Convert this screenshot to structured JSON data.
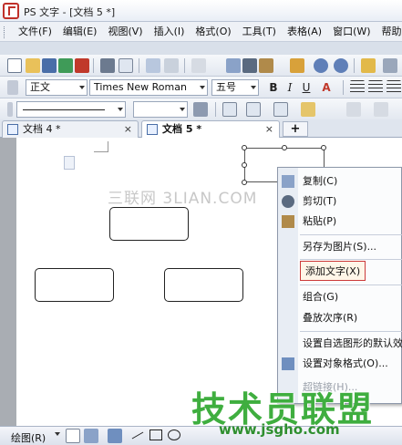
{
  "window": {
    "title": "PS 文字 - [文档 5 *]"
  },
  "menu": {
    "items": [
      {
        "label": "文件(F)"
      },
      {
        "label": "编辑(E)"
      },
      {
        "label": "视图(V)"
      },
      {
        "label": "插入(I)"
      },
      {
        "label": "格式(O)"
      },
      {
        "label": "工具(T)"
      },
      {
        "label": "表格(A)"
      },
      {
        "label": "窗口(W)"
      },
      {
        "label": "帮助(H)"
      }
    ]
  },
  "format_toolbar": {
    "style": "正文",
    "font": "Times New Roman",
    "size": "五号",
    "bold": "B",
    "italic": "I",
    "underline": "U",
    "font_color": "A"
  },
  "tabs": [
    {
      "label": "文档 4 *",
      "close": "×"
    },
    {
      "label": "文档 5 *",
      "close": "×"
    }
  ],
  "new_tab": "+",
  "watermark": {
    "top": "三联网 3LIAN.COM",
    "brand": "技术员联盟",
    "url": "www.jsgho.com"
  },
  "context_menu": {
    "items": [
      {
        "label": "复制(C)",
        "icon": "copy-icon"
      },
      {
        "label": "剪切(T)",
        "icon": "scissors-icon"
      },
      {
        "label": "粘贴(P)",
        "icon": "paste-icon"
      },
      {
        "label": "另存为图片(S)..."
      },
      {
        "label": "添加文字(X)",
        "highlighted": true
      },
      {
        "label": "组合(G)"
      },
      {
        "label": "叠放次序(R)"
      },
      {
        "label": "设置自选图形的默认效果"
      },
      {
        "label": "设置对象格式(O)...",
        "icon": "format-icon"
      },
      {
        "label": "超链接(H)...",
        "disabled": true
      }
    ]
  },
  "draw_toolbar": {
    "label": "绘图(R)"
  },
  "colors": {
    "highlight_border": "#cc3a3a",
    "accent": "#3fae3f"
  }
}
